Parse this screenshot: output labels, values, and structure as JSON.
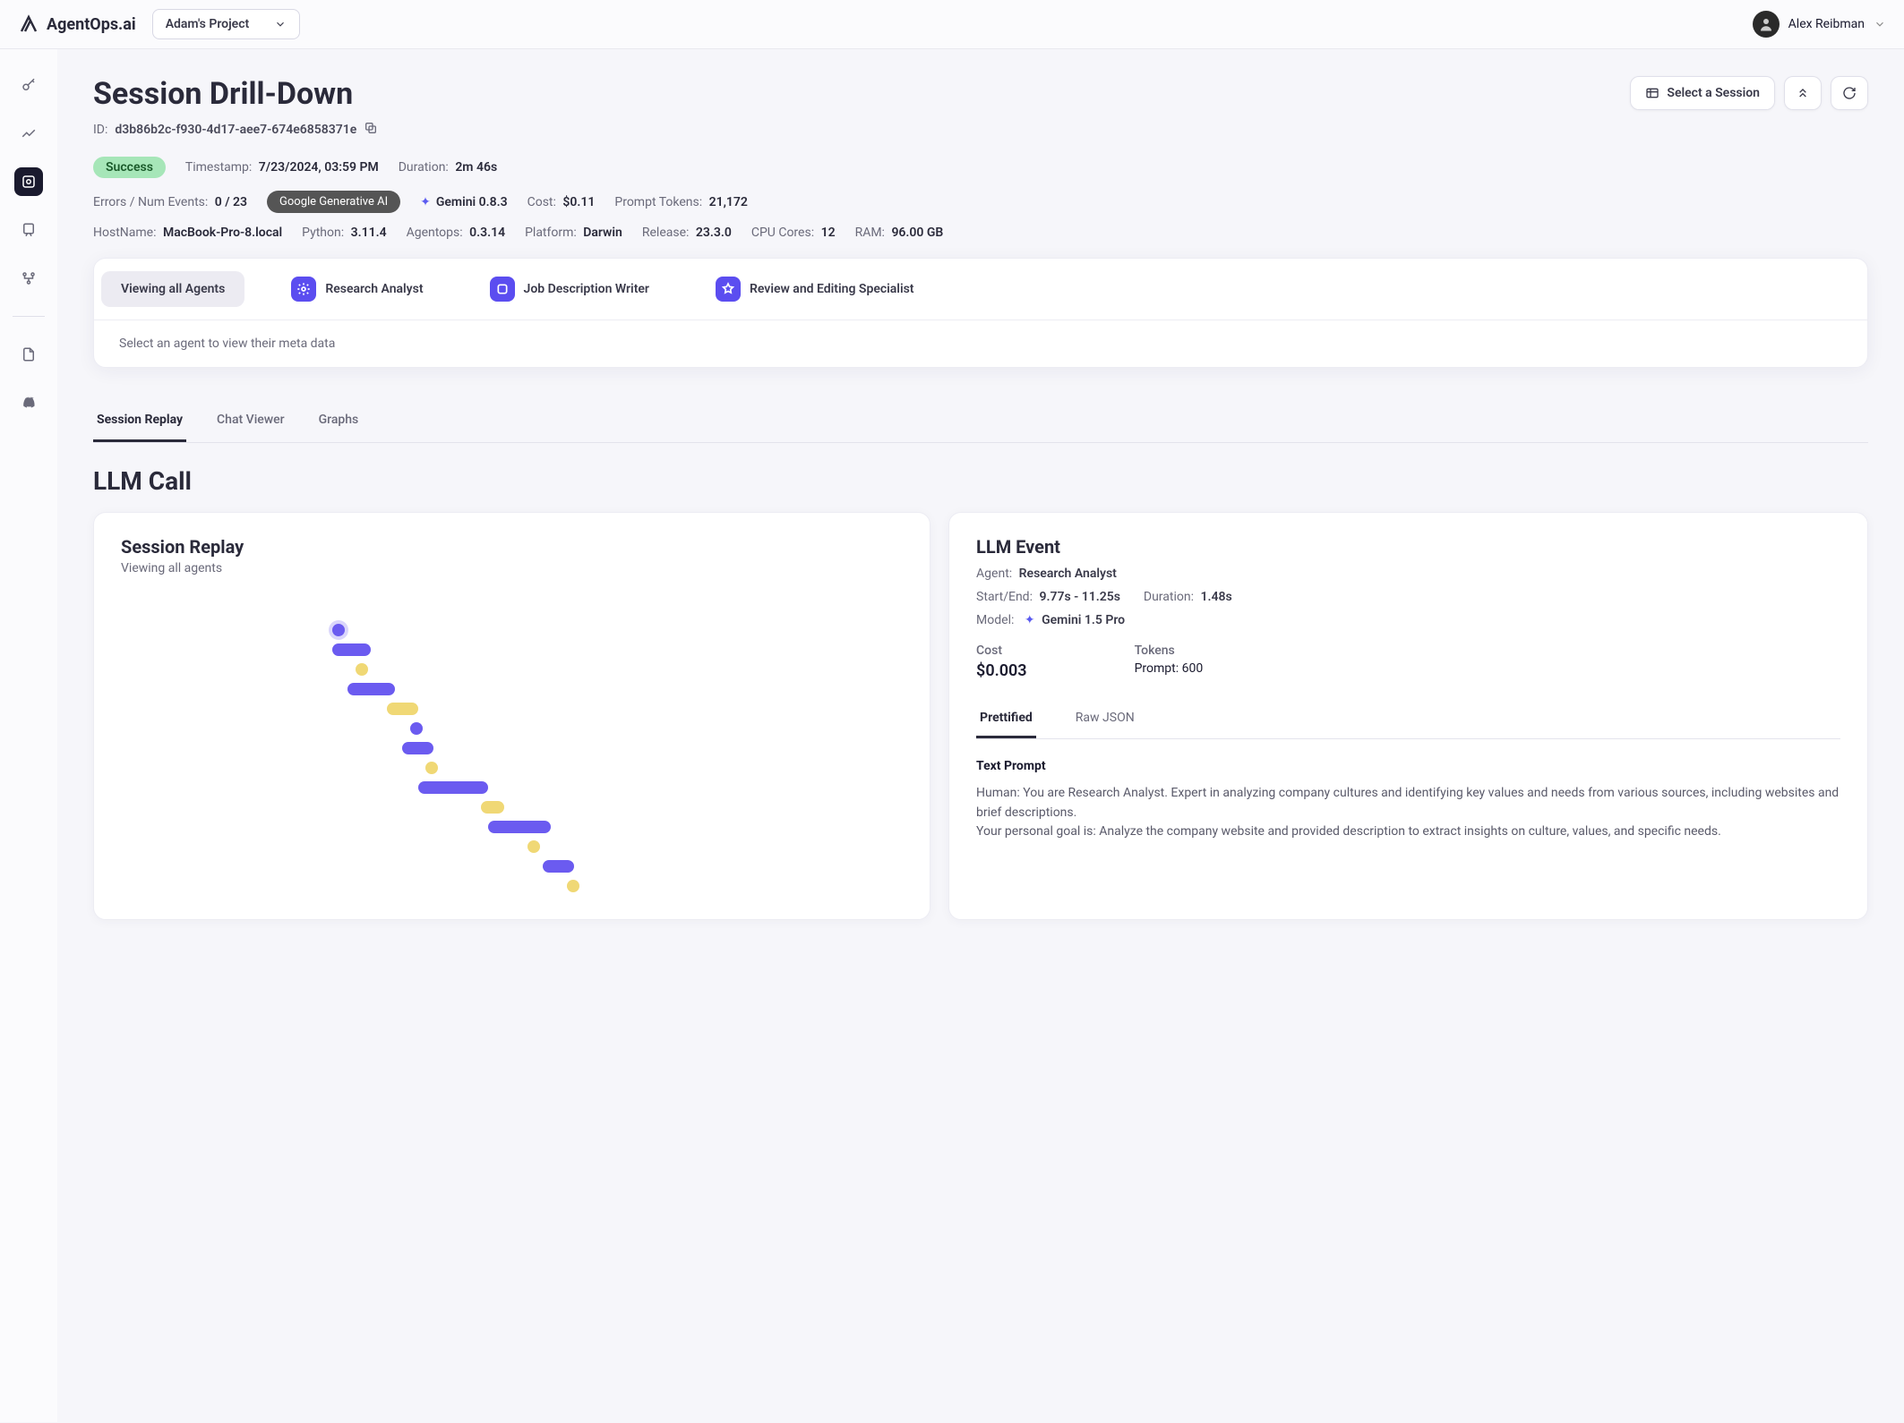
{
  "header": {
    "brand": "AgentOps.ai",
    "project": "Adam's Project",
    "user": "Alex Reibman"
  },
  "page": {
    "title": "Session Drill-Down",
    "id_label": "ID:",
    "id_value": "d3b86b2c-f930-4d17-aee7-674e6858371e",
    "actions": {
      "select_session": "Select a Session"
    }
  },
  "meta": {
    "status": "Success",
    "timestamp_label": "Timestamp:",
    "timestamp": "7/23/2024, 03:59 PM",
    "duration_label": "Duration:",
    "duration": "2m 46s",
    "errors_label": "Errors / Num Events:",
    "errors": "0 / 23",
    "provider": "Google Generative AI",
    "gemini": "Gemini 0.8.3",
    "cost_label": "Cost:",
    "cost": "$0.11",
    "ptokens_label": "Prompt Tokens:",
    "ptokens": "21,172",
    "host_label": "HostName:",
    "host": "MacBook-Pro-8.local",
    "python_label": "Python:",
    "python": "3.11.4",
    "agentops_label": "Agentops:",
    "agentops": "0.3.14",
    "platform_label": "Platform:",
    "platform": "Darwin",
    "release_label": "Release:",
    "release": "23.3.0",
    "cpu_label": "CPU Cores:",
    "cpu": "12",
    "ram_label": "RAM:",
    "ram": "96.00 GB"
  },
  "agents": {
    "all": "Viewing all Agents",
    "items": [
      {
        "label": "Research Analyst"
      },
      {
        "label": "Job Description Writer"
      },
      {
        "label": "Review and Editing Specialist"
      }
    ],
    "note": "Select an agent to view their meta data"
  },
  "tabs": {
    "replay": "Session Replay",
    "chat": "Chat Viewer",
    "graphs": "Graphs"
  },
  "section_title": "LLM Call",
  "replay_card": {
    "title": "Session Replay",
    "subtitle": "Viewing all agents"
  },
  "event": {
    "title": "LLM Event",
    "agent_label": "Agent:",
    "agent": "Research Analyst",
    "startend_label": "Start/End:",
    "startend": "9.77s - 11.25s",
    "duration_label": "Duration:",
    "duration": "1.48s",
    "model_label": "Model:",
    "model": "Gemini 1.5 Pro",
    "cost_hdr": "Cost",
    "cost_val": "$0.003",
    "tokens_hdr": "Tokens",
    "tokens_label": "Prompt:",
    "tokens_val": "600",
    "tabs": {
      "pretty": "Prettified",
      "raw": "Raw JSON"
    },
    "prompt_title": "Text Prompt",
    "prompt_line1": "Human: You are Research Analyst. Expert in analyzing company cultures and identifying key values and needs from various sources, including websites and brief descriptions.",
    "prompt_line2": "Your personal goal is: Analyze the company website and provided description to extract insights on culture, values, and specific needs."
  },
  "chart_data": {
    "type": "gantt",
    "title": "Session Replay",
    "note": "timeline bars (two categories interleaved); x positions/widths in % of visible range",
    "items": [
      {
        "kind": "dot",
        "color": "purple",
        "x": 27,
        "ring": true
      },
      {
        "kind": "bar",
        "color": "purple",
        "x": 27,
        "w": 5
      },
      {
        "kind": "dot",
        "color": "yellow",
        "x": 30
      },
      {
        "kind": "bar",
        "color": "purple",
        "x": 29,
        "w": 6
      },
      {
        "kind": "bar",
        "color": "yellow",
        "x": 34,
        "w": 4
      },
      {
        "kind": "dot",
        "color": "purple",
        "x": 37
      },
      {
        "kind": "bar",
        "color": "purple",
        "x": 36,
        "w": 4
      },
      {
        "kind": "dot",
        "color": "yellow",
        "x": 39
      },
      {
        "kind": "bar",
        "color": "purple",
        "x": 38,
        "w": 9
      },
      {
        "kind": "bar",
        "color": "yellow",
        "x": 46,
        "w": 3
      },
      {
        "kind": "bar",
        "color": "purple",
        "x": 47,
        "w": 8
      },
      {
        "kind": "dot",
        "color": "yellow",
        "x": 52
      },
      {
        "kind": "bar",
        "color": "purple",
        "x": 54,
        "w": 4
      },
      {
        "kind": "dot",
        "color": "yellow",
        "x": 57
      }
    ]
  }
}
